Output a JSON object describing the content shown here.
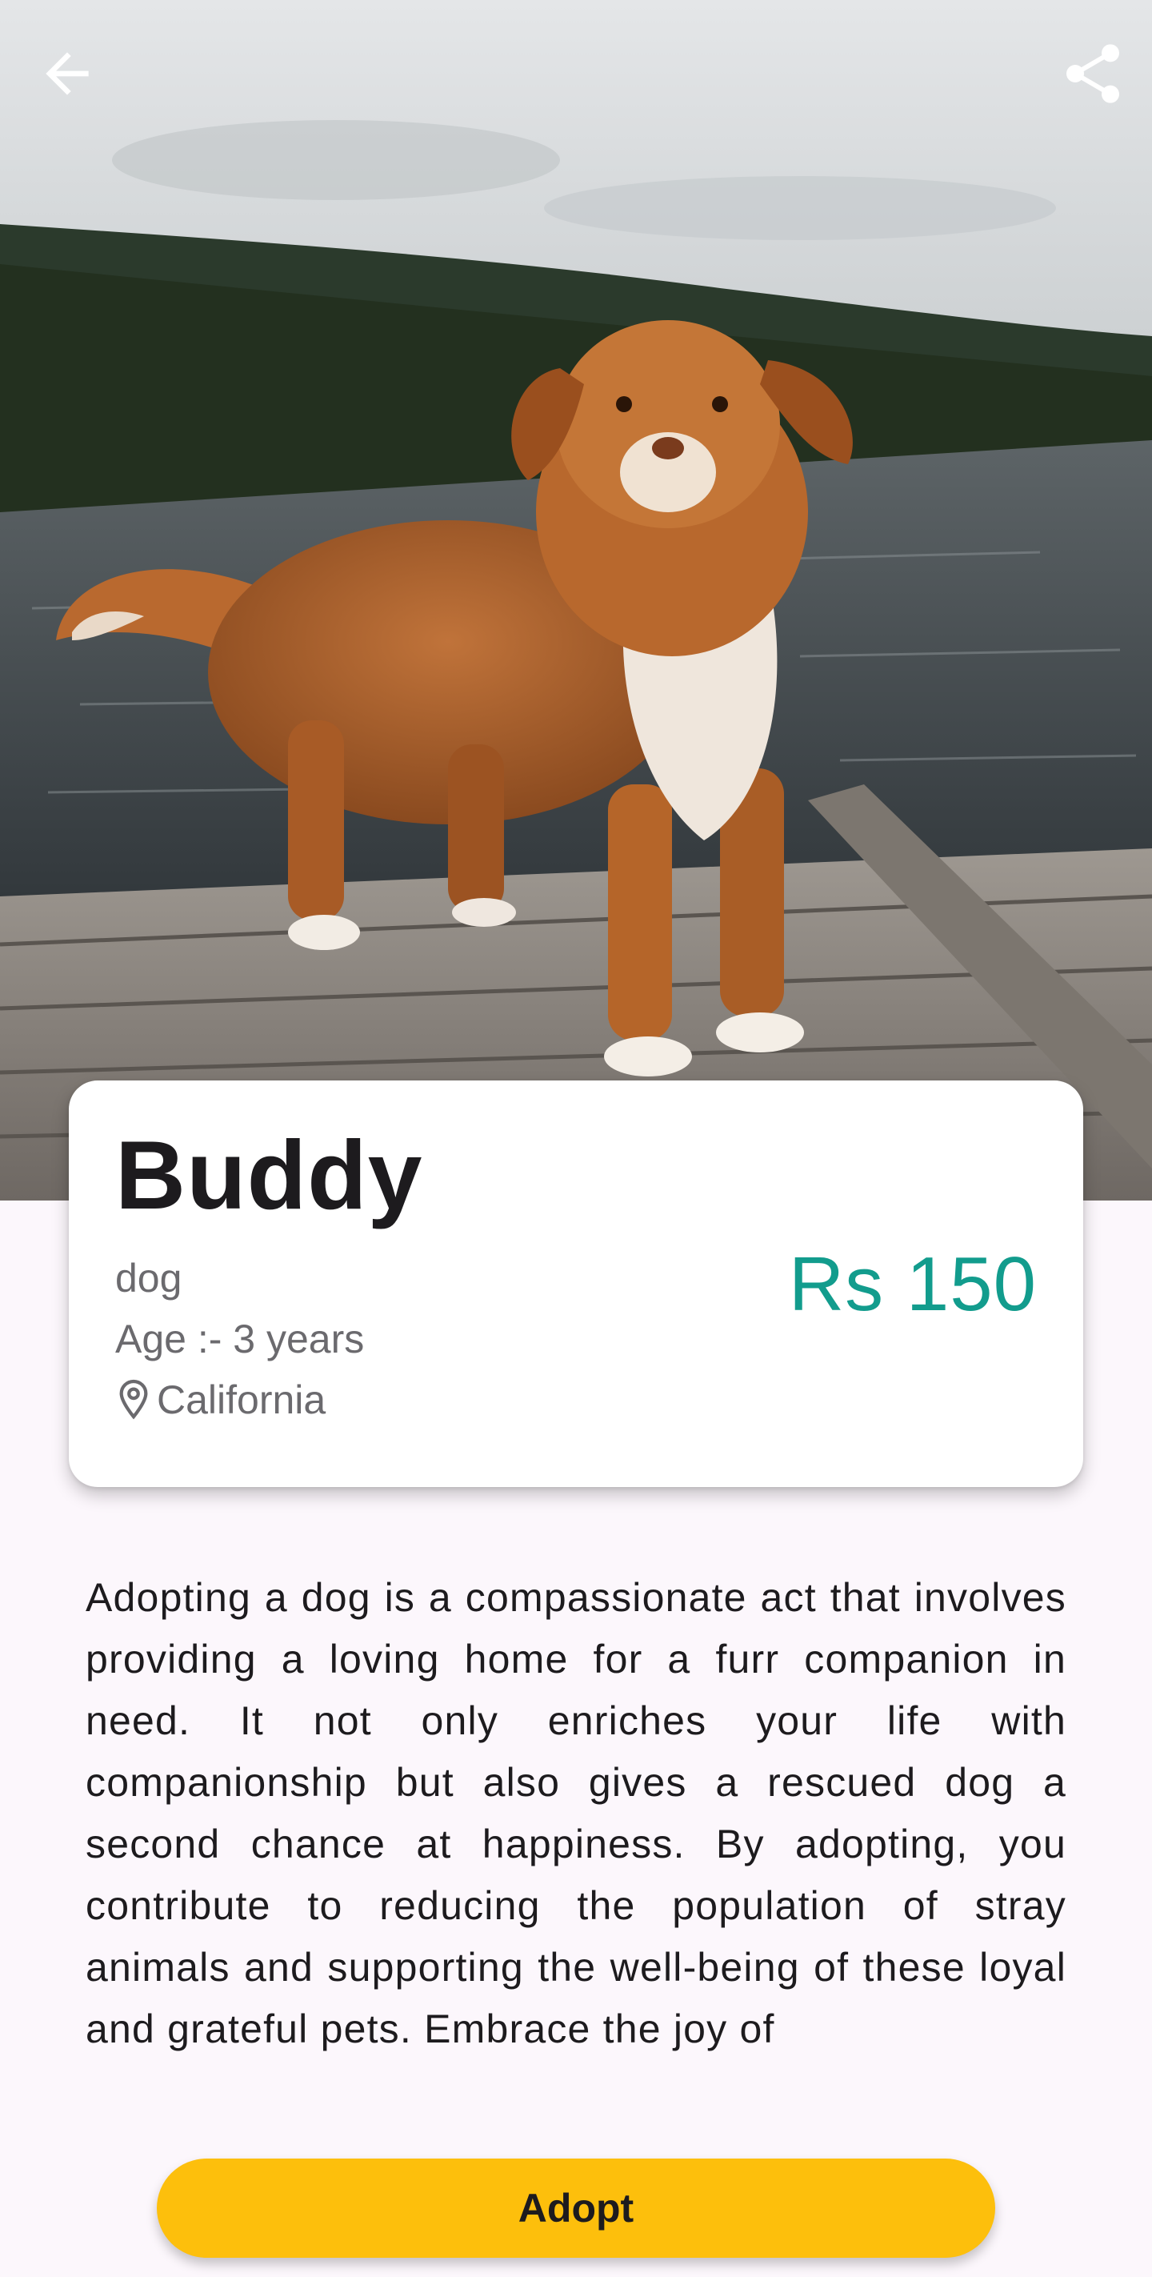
{
  "header": {
    "back_icon": "arrow-back-icon",
    "share_icon": "share-icon"
  },
  "pet": {
    "name": "Buddy",
    "type": "dog",
    "age": "Age :- 3 years",
    "location": "California",
    "location_icon": "location-pin-icon",
    "price": "Rs 150"
  },
  "description": "Adopting a dog is a compassionate act that involves providing a loving home for a furr companion in need. It not only enriches your life with companionship but also gives a rescued dog a second chance at happiness. By adopting, you contribute to reducing the population of stray animals and supporting the well-being of these loyal and grateful pets. Embrace the joy of",
  "actions": {
    "adopt_label": "Adopt"
  },
  "colors": {
    "accent_price": "#129c8d",
    "adopt_button": "#fdbf0c",
    "background": "#fcf7fc"
  }
}
